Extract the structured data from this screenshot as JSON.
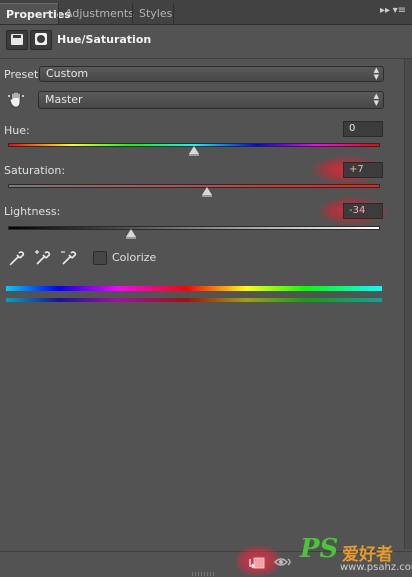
{
  "tabs": [
    {
      "label": "Properties",
      "active": true
    },
    {
      "label": "Adjustments",
      "active": false
    },
    {
      "label": "Styles",
      "active": false
    }
  ],
  "tab_menu_glyph": "▸▸",
  "tab_list_glyph": "▾≡",
  "header": {
    "title": "Hue/Saturation",
    "icons": [
      "adjustment-layer-icon",
      "layer-mask-icon"
    ]
  },
  "preset": {
    "label": "Preset:",
    "value": "Custom"
  },
  "channel": {
    "value": "Master",
    "icon": "targeted-adjustment-hand-icon"
  },
  "sliders": {
    "hue": {
      "label": "Hue:",
      "value": "0",
      "position": 0.5
    },
    "saturation": {
      "label": "Saturation:",
      "value": "+7",
      "position": 0.535
    },
    "lightness": {
      "label": "Lightness:",
      "value": "-34",
      "position": 0.33
    }
  },
  "tools": [
    "eyedropper-icon",
    "eyedropper-plus-icon",
    "eyedropper-minus-icon"
  ],
  "colorize": {
    "label": "Colorize",
    "checked": false
  },
  "footer_icons": [
    "clip-to-layer-icon",
    "view-previous-state-icon"
  ],
  "watermark": {
    "brand": "PS",
    "chinese": "爱好者",
    "url": "www.psahz.com"
  },
  "colors": {
    "panel_bg": "#535353",
    "highlight_glow": "#e6283c",
    "watermark_green": "#4bc43a",
    "watermark_orange": "#e89a2a"
  }
}
